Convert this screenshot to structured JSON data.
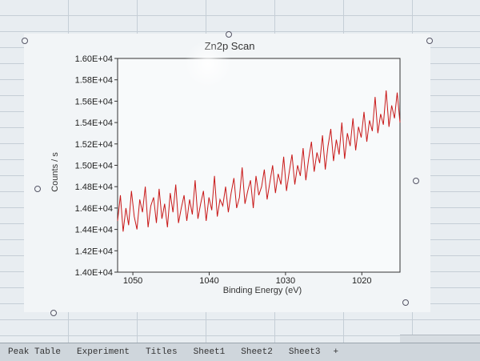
{
  "chart_data": {
    "type": "line",
    "title": "Zn2p Scan",
    "xlabel": "Binding Energy (eV)",
    "ylabel": "Counts / s",
    "xlim": [
      1052,
      1015
    ],
    "ylim": [
      14000,
      16000
    ],
    "x_reversed": true,
    "xticks": [
      1050,
      1040,
      1030,
      1020
    ],
    "xtick_labels": [
      "1050",
      "1040",
      "1030",
      "1020"
    ],
    "yticks": [
      14000,
      14200,
      14400,
      14600,
      14800,
      15000,
      15200,
      15400,
      15600,
      15800,
      16000
    ],
    "ytick_labels": [
      "1.40E+04",
      "1.42E+04",
      "1.44E+04",
      "1.46E+04",
      "1.48E+04",
      "1.50E+04",
      "1.52E+04",
      "1.54E+04",
      "1.56E+04",
      "1.58E+04",
      "1.60E+04"
    ],
    "grid": false,
    "legend": "none",
    "series": [
      {
        "color": "#c81818",
        "x_start": 1052,
        "x_end": 1015,
        "values": [
          14480,
          14720,
          14380,
          14600,
          14440,
          14760,
          14520,
          14400,
          14680,
          14560,
          14800,
          14420,
          14620,
          14700,
          14460,
          14780,
          14500,
          14640,
          14420,
          14740,
          14560,
          14820,
          14460,
          14600,
          14720,
          14480,
          14680,
          14540,
          14860,
          14500,
          14640,
          14760,
          14480,
          14700,
          14580,
          14900,
          14520,
          14680,
          14620,
          14800,
          14560,
          14740,
          14880,
          14600,
          14700,
          14980,
          14640,
          14760,
          14860,
          14600,
          14900,
          14720,
          14800,
          14960,
          14680,
          14840,
          15000,
          14740,
          14920,
          14820,
          15080,
          14760,
          14940,
          15100,
          14820,
          15000,
          14900,
          15160,
          14860,
          15060,
          15220,
          14940,
          15120,
          15020,
          15280,
          14960,
          15180,
          15340,
          15040,
          15240,
          15100,
          15400,
          15060,
          15300,
          15180,
          15440,
          15140,
          15360,
          15260,
          15500,
          15220,
          15420,
          15320,
          15640,
          15300,
          15480,
          15380,
          15700,
          15360,
          15560,
          15440,
          15680,
          15400
        ]
      }
    ]
  },
  "sheet_tabs": [
    "Peak Table",
    "Experiment",
    "Titles",
    "Sheet1",
    "Sheet2",
    "Sheet3"
  ],
  "add_tab_label": "+"
}
